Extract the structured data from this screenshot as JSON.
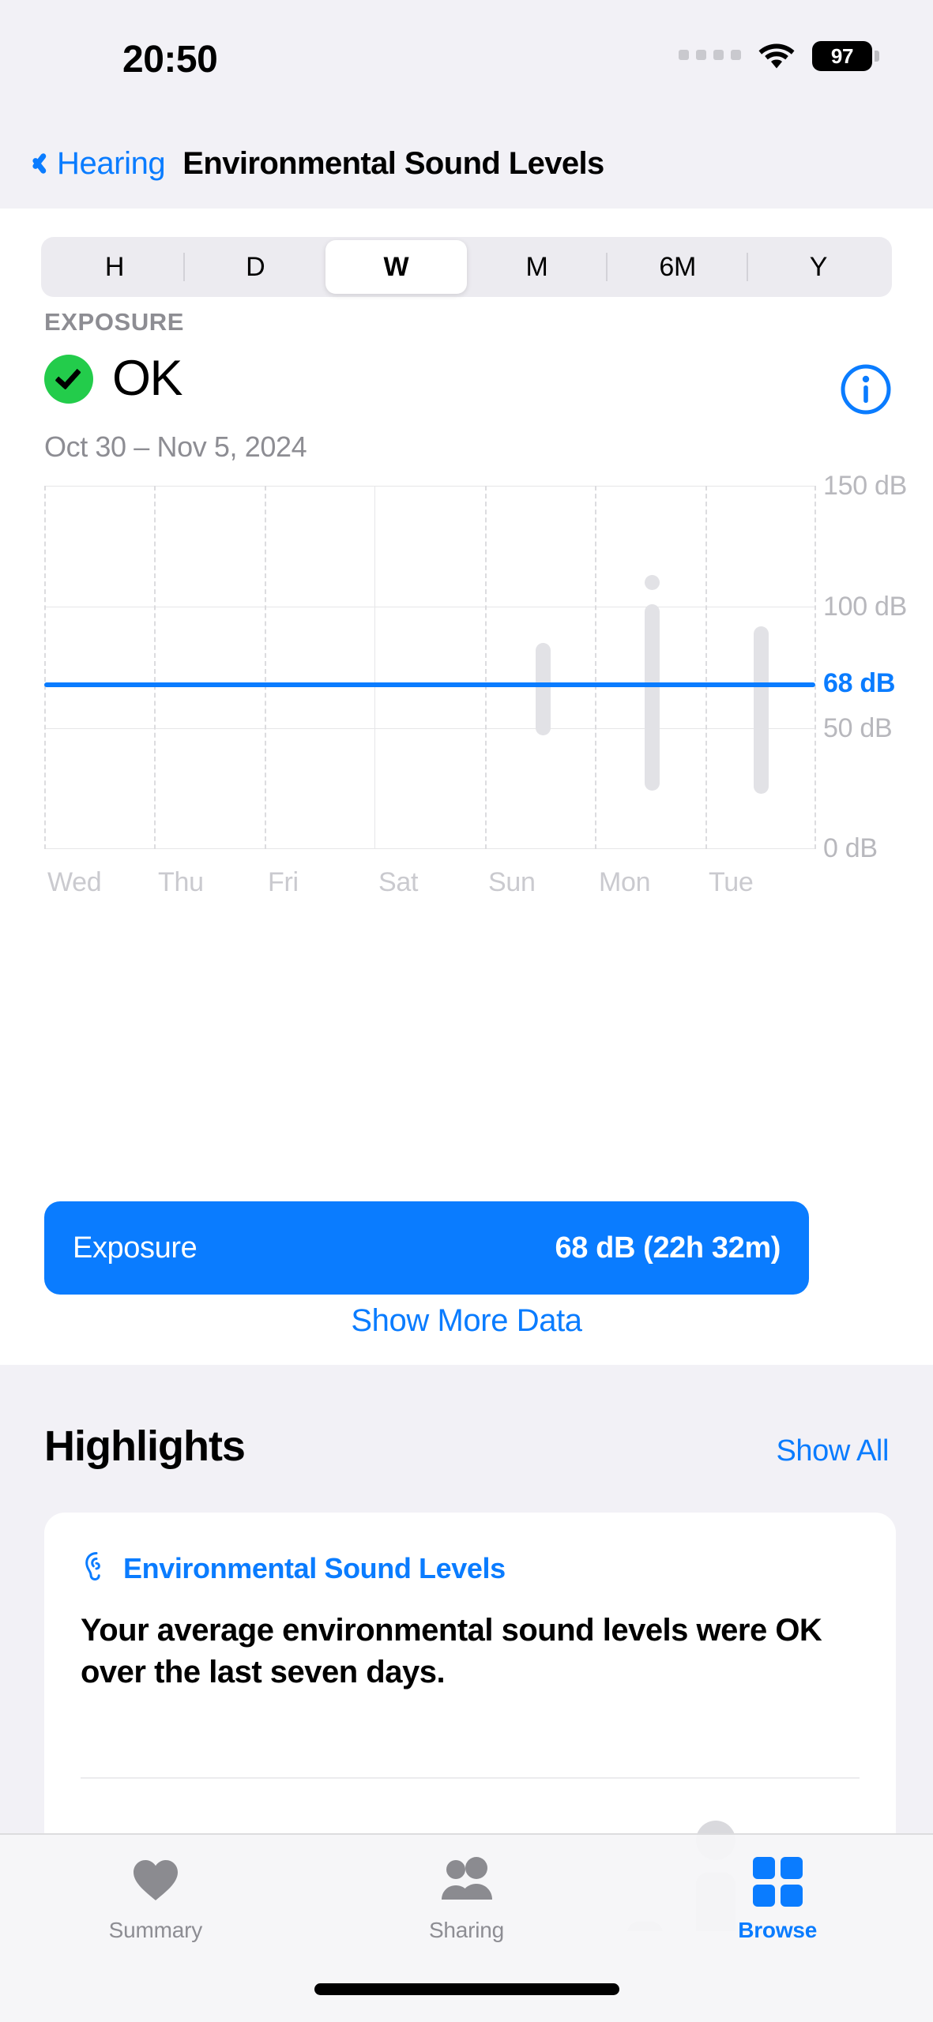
{
  "statusbar": {
    "time": "20:50",
    "battery_level": "97",
    "wifi_icon": "wifi-icon",
    "cellular_icon": "cellular-dots-icon"
  },
  "navbar": {
    "back_label": "Hearing",
    "title": "Environmental Sound Levels",
    "back_icon": "chevron-left-icon"
  },
  "segmented_control": {
    "selected": "W",
    "options": [
      {
        "label": "H"
      },
      {
        "label": "D"
      },
      {
        "label": "W"
      },
      {
        "label": "M"
      },
      {
        "label": "6M"
      },
      {
        "label": "Y"
      }
    ]
  },
  "exposure": {
    "section_label": "EXPOSURE",
    "status": "OK",
    "status_icon": "check-circle-icon",
    "status_color": "#23cc4b",
    "date_range": "Oct 30 – Nov 5, 2024",
    "info_icon": "info-circle-icon"
  },
  "chart_data": {
    "type": "bar",
    "title": "Environmental Sound Levels",
    "xlabel": "",
    "ylabel": "dB",
    "ylim": [
      0,
      150
    ],
    "grid": true,
    "categories": [
      "Wed",
      "Thu",
      "Fri",
      "Sat",
      "Sun",
      "Mon",
      "Tue"
    ],
    "ytick_labels": [
      "150 dB",
      "100 dB",
      "50 dB",
      "0 dB"
    ],
    "ytick_values": [
      150,
      100,
      50,
      0
    ],
    "average_line": {
      "label": "68 dB",
      "value": 68,
      "color": "#0a7cff"
    },
    "bar_color": "#e2e2e6",
    "series": [
      {
        "name": "range_min",
        "values": [
          null,
          null,
          null,
          null,
          47,
          24,
          23
        ]
      },
      {
        "name": "range_max",
        "values": [
          null,
          null,
          null,
          null,
          85,
          101,
          92
        ]
      }
    ],
    "outliers": [
      {
        "category": "Mon",
        "value": 108
      }
    ]
  },
  "summary_bar": {
    "label": "Exposure",
    "value": "68 dB (22h 32m)",
    "color": "#0a7cff"
  },
  "show_more": {
    "label": "Show More Data"
  },
  "highlights": {
    "title": "Highlights",
    "show_all_label": "Show All",
    "card": {
      "icon": "ear-icon",
      "title": "Environmental Sound Levels",
      "body": "Your average environmental sound levels were OK over the last seven days."
    }
  },
  "tabbar": {
    "items": [
      {
        "label": "Summary",
        "icon": "heart-icon",
        "active": false
      },
      {
        "label": "Sharing",
        "icon": "people-icon",
        "active": false
      },
      {
        "label": "Browse",
        "icon": "grid-icon",
        "active": true
      }
    ]
  }
}
